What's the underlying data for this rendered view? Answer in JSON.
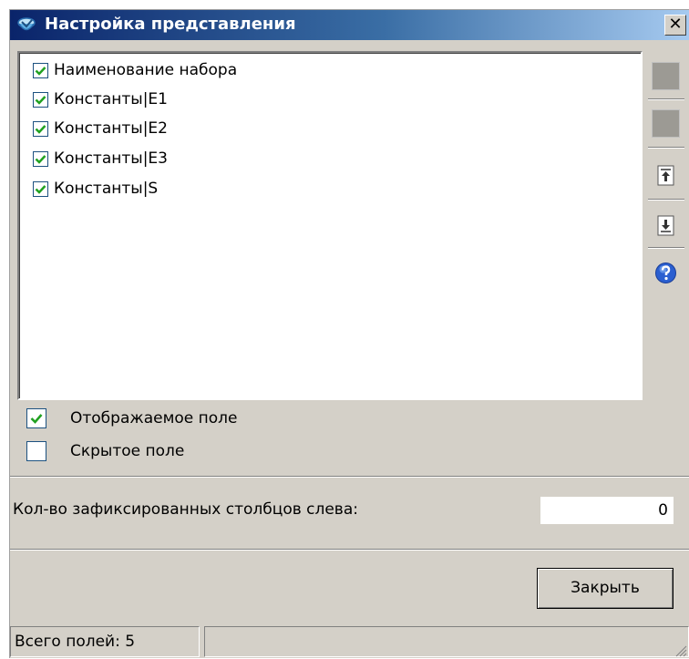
{
  "window": {
    "title": "Настройка представления",
    "close_glyph": "✕"
  },
  "fields": [
    {
      "label": "Наименование набора",
      "checked": true
    },
    {
      "label": "Константы|E1",
      "checked": true
    },
    {
      "label": "Константы|E2",
      "checked": true
    },
    {
      "label": "Константы|E3",
      "checked": true
    },
    {
      "label": "Константы|S",
      "checked": true
    }
  ],
  "toolbar": {
    "icons": [
      "move-right-icon",
      "move-left-icon",
      "move-up-icon",
      "move-down-icon",
      "help-icon"
    ]
  },
  "options": {
    "visible_label": "Отображаемое поле",
    "visible_checked": true,
    "hidden_label": "Скрытое поле",
    "hidden_checked": false
  },
  "frozen": {
    "label": "Кол-во зафиксированных столбцов слева:",
    "value": "0"
  },
  "buttons": {
    "close_label": "Закрыть"
  },
  "status": {
    "total": "Всего полей: 5",
    "second": ""
  },
  "colors": {
    "title_start": "#0a246a",
    "title_end": "#a6caf0",
    "check": "#21a121",
    "face": "#d4d0c8"
  }
}
